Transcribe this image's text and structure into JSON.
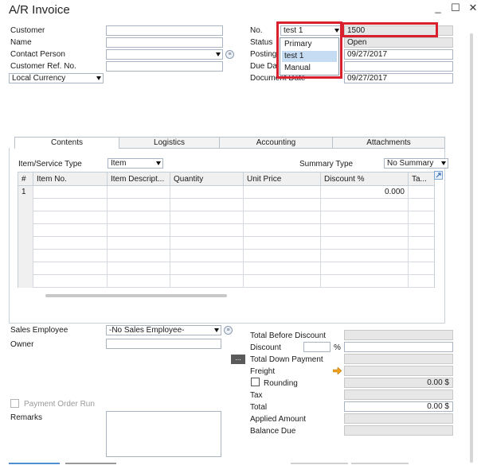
{
  "window": {
    "title": "A/R Invoice",
    "minimize": "_",
    "maximize": "☐",
    "close": "✕"
  },
  "header_left": {
    "customer_label": "Customer",
    "name_label": "Name",
    "contact_label": "Contact Person",
    "custref_label": "Customer Ref. No.",
    "currency_value": "Local Currency",
    "lookup_glyph": "≡"
  },
  "header_right": {
    "no_label": "No.",
    "series_value": "test 1",
    "doc_number": "1500",
    "status_label": "Status",
    "status_value": "Open",
    "posting_label": "Posting",
    "posting_value": "09/27/2017",
    "due_label": "Due Da",
    "document_date_label": "Document Date",
    "document_date_value": "09/27/2017",
    "series_options": [
      "Primary",
      "test 1",
      "Manual"
    ],
    "series_selected": "test 1"
  },
  "tabs": [
    {
      "label": "Contents",
      "active": true
    },
    {
      "label": "Logistics",
      "active": false
    },
    {
      "label": "Accounting",
      "active": false
    },
    {
      "label": "Attachments",
      "active": false
    }
  ],
  "contents": {
    "item_type_label": "Item/Service Type",
    "item_type_value": "Item",
    "summary_type_label": "Summary Type",
    "summary_type_value": "No Summary",
    "columns": [
      "#",
      "Item No.",
      "Item Descript...",
      "Quantity",
      "Unit Price",
      "Discount %",
      "Ta..."
    ],
    "rows": [
      {
        "num": "1",
        "discount": "0.000"
      }
    ],
    "empty_rows": 7
  },
  "footer_left": {
    "sales_employee_label": "Sales Employee",
    "sales_employee_value": "-No Sales Employee-",
    "owner_label": "Owner",
    "payment_order_run_label": "Payment Order Run",
    "remarks_label": "Remarks"
  },
  "totals": {
    "total_before_discount_label": "Total Before Discount",
    "discount_label": "Discount",
    "percent_sign": "%",
    "more_button": "...",
    "total_down_payment_label": "Total Down Payment",
    "freight_label": "Freight",
    "rounding_label": "Rounding",
    "rounding_value": "0.00 $",
    "tax_label": "Tax",
    "total_label": "Total",
    "total_value": "0.00 $",
    "applied_amount_label": "Applied Amount",
    "balance_due_label": "Balance Due"
  },
  "colors": {
    "highlight_border": "#d9202e",
    "selected_option": "#c5dcf2",
    "arrow": "#f0a11c"
  }
}
